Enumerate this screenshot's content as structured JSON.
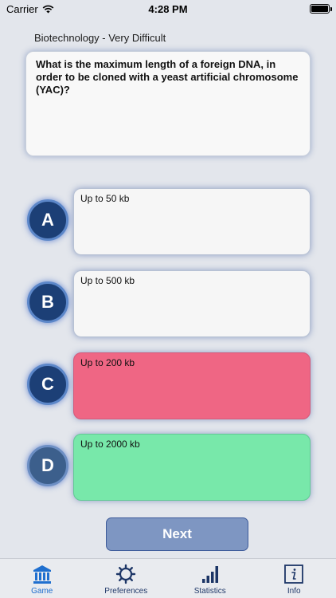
{
  "status_bar": {
    "carrier": "Carrier",
    "time": "4:28 PM"
  },
  "category": "Biotechnology - Very Difficult",
  "question": "What is the maximum length of a foreign DNA, in order to be cloned with a yeast artificial chromosome (YAC)?",
  "answers": [
    {
      "letter": "A",
      "text": "Up to  50 kb",
      "state": "neutral"
    },
    {
      "letter": "B",
      "text": "Up to  500 kb",
      "state": "neutral"
    },
    {
      "letter": "C",
      "text": "Up to  200 kb",
      "state": "wrong"
    },
    {
      "letter": "D",
      "text": "Up to 2000 kb",
      "state": "correct"
    }
  ],
  "next_label": "Next",
  "tabs": [
    {
      "label": "Game",
      "icon": "bank-icon",
      "active": true
    },
    {
      "label": "Preferences",
      "icon": "gear-icon",
      "active": false
    },
    {
      "label": "Statistics",
      "icon": "bar-chart-icon",
      "active": false
    },
    {
      "label": "Info",
      "icon": "info-icon",
      "active": false
    }
  ],
  "colors": {
    "accent_blue": "#1f6fcf",
    "circle_blue": "#1c3f76",
    "wrong_red": "#ef6684",
    "correct_green": "#78e8aa",
    "next_button": "#7e96c2"
  }
}
